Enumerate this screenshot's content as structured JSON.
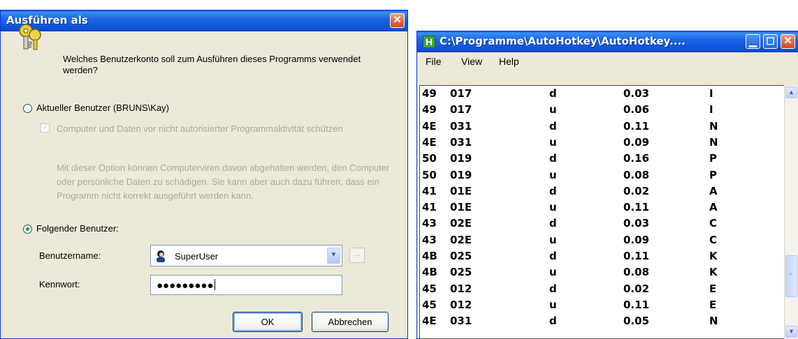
{
  "runas": {
    "title": "Ausführen als",
    "question": "Welches Benutzerkonto soll zum Ausführen dieses Programms verwendet werden?",
    "current_user_label": "Aktueller Benutzer (BRUNS\\Kay)",
    "protect_label": "Computer und Daten vor nicht autorisierter Programmaktivität schützen",
    "protect_note": "Mit dieser Option können Computerviren davon abgehalten werden, den Computer oder persönliche Daten zu schädigen. Sie kann aber auch dazu führen, dass ein Programm nicht korrekt ausgeführt werden kann.",
    "following_user_label": "Folgender Benutzer:",
    "username_label": "Benutzername:",
    "username_value": "SuperUser",
    "password_label": "Kennwort:",
    "password_mask": "●●●●●●●●●",
    "browse_label": "...",
    "ok_label": "OK",
    "cancel_label": "Abbrechen"
  },
  "ahk": {
    "title": "C:\\Programme\\AutoHotkey\\AutoHotkey....",
    "icon_letter": "H",
    "menu": [
      "File",
      "View",
      "Help"
    ],
    "rows": [
      [
        "49",
        "017",
        "d",
        "0.03",
        "I"
      ],
      [
        "49",
        "017",
        "u",
        "0.06",
        "I"
      ],
      [
        "4E",
        "031",
        "d",
        "0.11",
        "N"
      ],
      [
        "4E",
        "031",
        "u",
        "0.09",
        "N"
      ],
      [
        "50",
        "019",
        "d",
        "0.16",
        "P"
      ],
      [
        "50",
        "019",
        "u",
        "0.08",
        "P"
      ],
      [
        "41",
        "01E",
        "d",
        "0.02",
        "A"
      ],
      [
        "41",
        "01E",
        "u",
        "0.11",
        "A"
      ],
      [
        "43",
        "02E",
        "d",
        "0.03",
        "C"
      ],
      [
        "43",
        "02E",
        "u",
        "0.09",
        "C"
      ],
      [
        "4B",
        "025",
        "d",
        "0.11",
        "K"
      ],
      [
        "4B",
        "025",
        "u",
        "0.08",
        "K"
      ],
      [
        "45",
        "012",
        "d",
        "0.02",
        "E"
      ],
      [
        "45",
        "012",
        "u",
        "0.11",
        "E"
      ],
      [
        "4E",
        "031",
        "d",
        "0.05",
        "N"
      ]
    ]
  }
}
